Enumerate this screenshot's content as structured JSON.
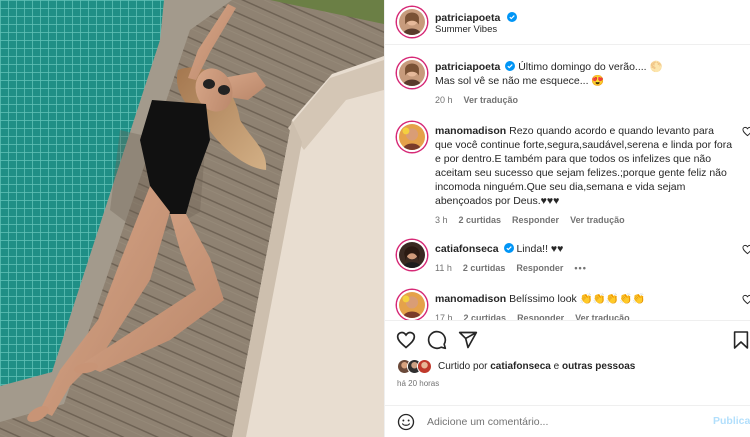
{
  "post": {
    "author": "patriciapoeta",
    "location": "Summer Vibes"
  },
  "caption": {
    "author": "patriciapoeta",
    "line1": "Último domingo do verão....",
    "line2": "Mas sol vê se não me esquece...",
    "line1_emoji": "🌕",
    "line2_emoji": "😍",
    "time": "20 h",
    "translate": "Ver tradução"
  },
  "comments": [
    {
      "user": "manomadison",
      "lines": [
        "Rezo quando acordo e quando levanto para",
        "que você continue forte,segura,saudável,serena e linda por fora",
        "e por dentro.E também para que todos os infelizes que não",
        "aceitam seu sucesso que sejam felizes.;porque gente feliz não",
        "incomoda ninguém.Que seu dia,semana e vida sejam",
        "abençoados por Deus.♥♥♥"
      ],
      "time": "3 h",
      "likes": "2 curtidas",
      "reply": "Responder",
      "translate": "Ver tradução"
    },
    {
      "user": "catiafonseca",
      "text": "Linda!! ♥♥",
      "time": "11 h",
      "likes": "2 curtidas",
      "reply": "Responder",
      "more": "•••"
    },
    {
      "user": "manomadison",
      "text": "Belíssimo look",
      "emoji": "👏👏👏👏👏",
      "time": "17 h",
      "likes": "2 curtidas",
      "reply": "Responder",
      "translate": "Ver tradução"
    }
  ],
  "likes": {
    "prefix": "Curtido por",
    "user": "catiafonseca",
    "connector": "e",
    "others": "outras pessoas"
  },
  "posted": "há 20 horas",
  "add_comment": {
    "placeholder": "Adicione um comentário...",
    "publish": "Publicar"
  },
  "colors": {
    "verified": "#0095f6",
    "link": "#0095f6",
    "publish_disabled": "#b2dffc",
    "story_ring": "#d62976",
    "muted": "#737373"
  },
  "icons": [
    "verified-badge-icon",
    "heart-icon",
    "comment-icon",
    "share-icon",
    "bookmark-icon",
    "emoji-icon"
  ]
}
